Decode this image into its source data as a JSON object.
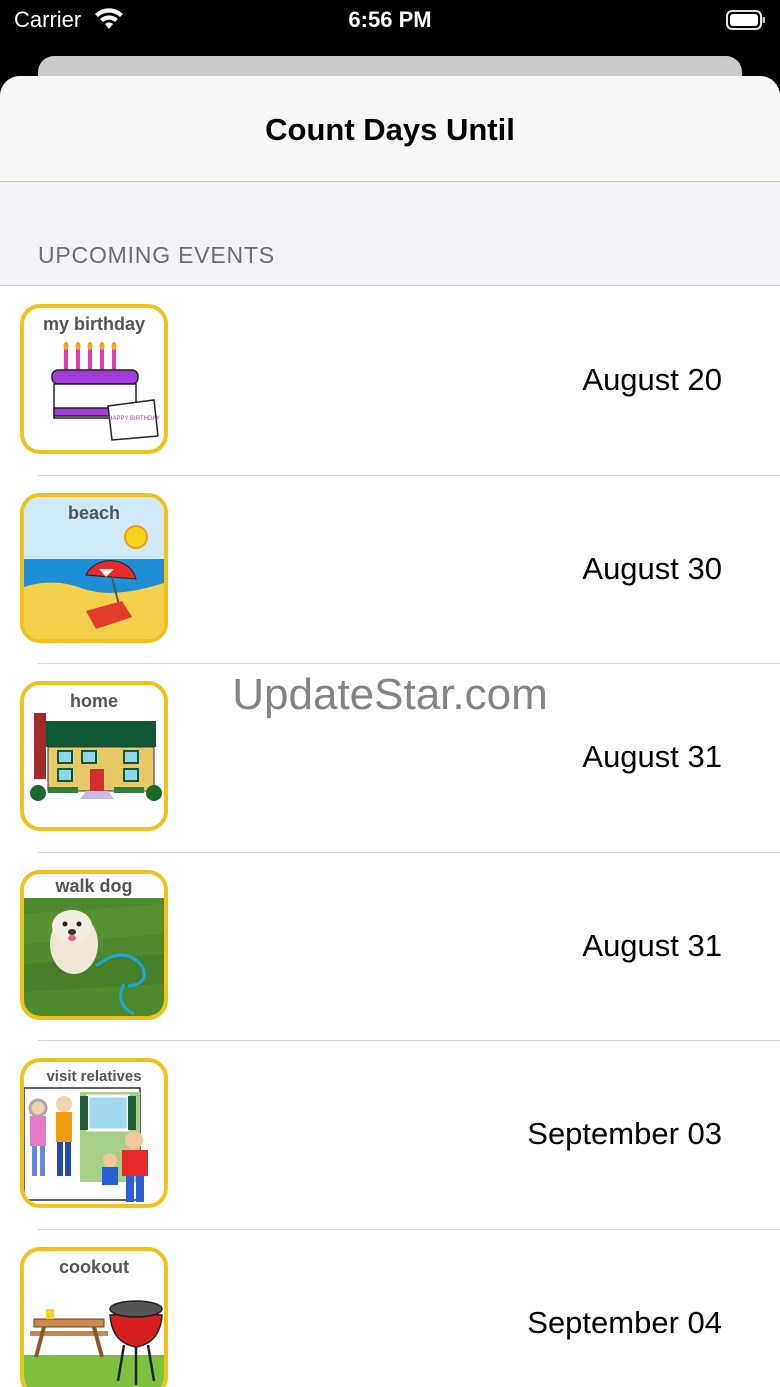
{
  "status_bar": {
    "carrier": "Carrier",
    "time": "6:56 PM",
    "icons": [
      "wifi-icon",
      "battery-icon"
    ]
  },
  "nav": {
    "title": "Count Days Until"
  },
  "section": {
    "title": "UPCOMING EVENTS"
  },
  "events": [
    {
      "label": "my birthday",
      "date": "August 20",
      "icon": "birthday-cake-icon",
      "card_text": "HAPPY BIRTHDAY"
    },
    {
      "label": "beach",
      "date": "August 30",
      "icon": "beach-icon"
    },
    {
      "label": "home",
      "date": "August 31",
      "icon": "house-icon"
    },
    {
      "label": "walk dog",
      "date": "August 31",
      "icon": "dog-photo"
    },
    {
      "label": "visit relatives",
      "date": "September 03",
      "icon": "relatives-icon"
    },
    {
      "label": "cookout",
      "date": "September 04",
      "icon": "grill-icon"
    }
  ],
  "watermark": "UpdateStar.com",
  "colors": {
    "thumb_border": "#f2c21b",
    "grouped_background": "#f2f2f7",
    "secondary_label": "#6d6d72"
  }
}
